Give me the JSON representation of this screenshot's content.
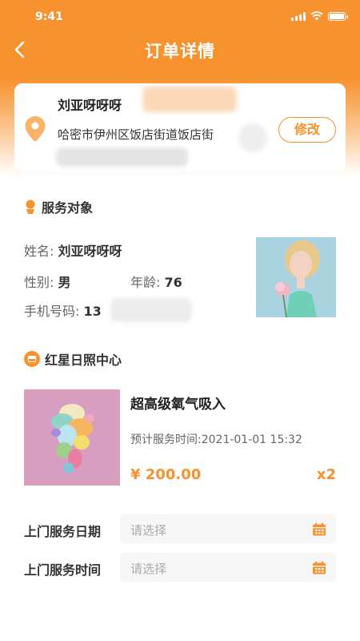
{
  "status": {
    "time": "9:41"
  },
  "nav": {
    "title": "订单详情"
  },
  "address": {
    "name": "刘亚呀呀呀",
    "text": "哈密市伊州区饭店街道饭店街",
    "edit_label": "修改"
  },
  "service_target": {
    "heading": "服务对象",
    "name_label": "姓名:",
    "name_value": "刘亚呀呀呀",
    "gender_label": "性别:",
    "gender_value": "男",
    "age_label": "年龄:",
    "age_value": "76",
    "phone_label": "手机号码:",
    "phone_value": "13"
  },
  "store": {
    "heading": "红星日照中心"
  },
  "product": {
    "title": "超高级氧气吸入",
    "time_label": "预计服务时间:",
    "time_value": "2021-01-01 15:32",
    "price": "¥ 200.00",
    "qty": "x2"
  },
  "form": {
    "date_label": "上门服务日期",
    "date_placeholder": "请选择",
    "time_label": "上门服务时间",
    "time_placeholder": "请选择"
  },
  "colors": {
    "accent": "#f7922f"
  }
}
